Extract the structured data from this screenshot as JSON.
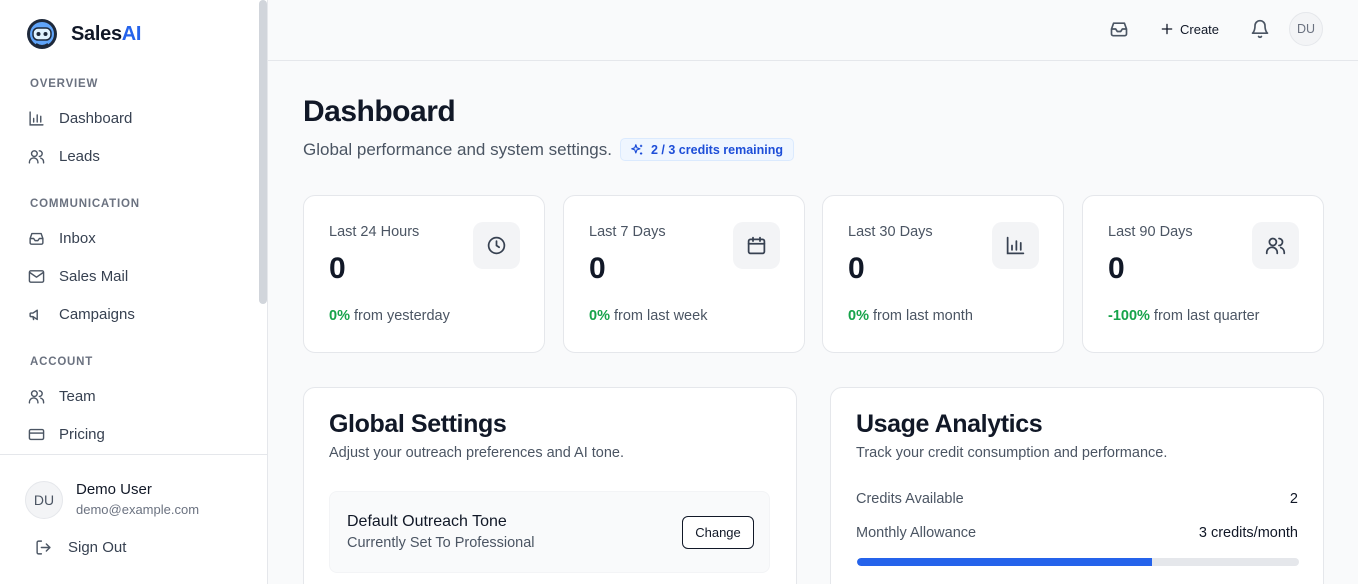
{
  "brand": {
    "name_main": "Sales",
    "name_accent": "AI"
  },
  "sidebar": {
    "sections": [
      {
        "label": "OVERVIEW",
        "items": [
          {
            "label": "Dashboard",
            "icon": "bar-chart-icon"
          },
          {
            "label": "Leads",
            "icon": "users-icon"
          }
        ]
      },
      {
        "label": "COMMUNICATION",
        "items": [
          {
            "label": "Inbox",
            "icon": "inbox-icon"
          },
          {
            "label": "Sales Mail",
            "icon": "mail-icon"
          },
          {
            "label": "Campaigns",
            "icon": "megaphone-icon"
          }
        ]
      },
      {
        "label": "ACCOUNT",
        "items": [
          {
            "label": "Team",
            "icon": "users-icon"
          },
          {
            "label": "Pricing",
            "icon": "credit-card-icon"
          }
        ]
      }
    ],
    "user": {
      "initials": "DU",
      "name": "Demo User",
      "email": "demo@example.com"
    },
    "sign_out": "Sign Out"
  },
  "topbar": {
    "create_label": "Create",
    "avatar_initials": "DU"
  },
  "header": {
    "title": "Dashboard",
    "subtitle": "Global performance and system settings.",
    "credits_badge": "2 / 3 credits remaining"
  },
  "stats": [
    {
      "label": "Last 24 Hours",
      "value": "0",
      "change": "0%",
      "change_text": "from yesterday",
      "icon": "clock-icon"
    },
    {
      "label": "Last 7 Days",
      "value": "0",
      "change": "0%",
      "change_text": "from last week",
      "icon": "calendar-icon"
    },
    {
      "label": "Last 30 Days",
      "value": "0",
      "change": "0%",
      "change_text": "from last month",
      "icon": "bar-chart-icon"
    },
    {
      "label": "Last 90 Days",
      "value": "0",
      "change": "-100%",
      "change_text": "from last quarter",
      "icon": "users-icon"
    }
  ],
  "global_settings": {
    "title": "Global Settings",
    "description": "Adjust your outreach preferences and AI tone.",
    "tone_title": "Default Outreach Tone",
    "tone_value": "Currently Set To Professional",
    "change_label": "Change"
  },
  "usage": {
    "title": "Usage Analytics",
    "description": "Track your credit consumption and performance.",
    "credits_available_label": "Credits Available",
    "credits_available_value": "2",
    "monthly_allowance_label": "Monthly Allowance",
    "monthly_allowance_value": "3 credits/month",
    "progress_fraction": 0.667
  },
  "colors": {
    "accent": "#2563eb",
    "positive": "#16a34a"
  }
}
